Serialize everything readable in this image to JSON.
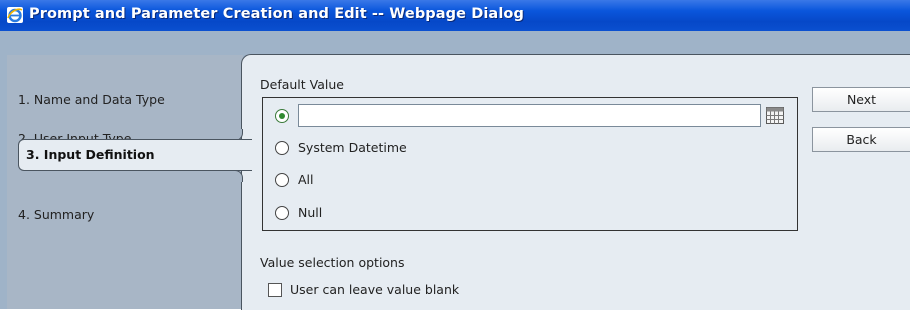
{
  "window": {
    "title": "Prompt and Parameter Creation and Edit -- Webpage Dialog"
  },
  "steps": [
    {
      "label": "1. Name and Data Type",
      "active": false
    },
    {
      "label": "2. User Input Type",
      "active": false
    },
    {
      "label": "3. Input Definition",
      "active": true
    },
    {
      "label": "4. Summary",
      "active": false
    }
  ],
  "default_value": {
    "label": "Default Value",
    "input_value": "",
    "options": [
      {
        "label": "",
        "checked": true
      },
      {
        "label": "System Datetime",
        "checked": false
      },
      {
        "label": "All",
        "checked": false
      },
      {
        "label": "Null",
        "checked": false
      }
    ]
  },
  "buttons": {
    "next": "Next",
    "back": "Back"
  },
  "value_selection": {
    "label": "Value selection options",
    "checkbox_label": "User can leave value blank",
    "checked": false
  },
  "icons": {
    "browser": "internet-explorer-icon",
    "calendar": "calendar-icon"
  },
  "colors": {
    "titlebar": "#0a56dc",
    "frame": "#9fb3c8",
    "panel": "#e6ecf2",
    "radio_selected": "#2f8a2f"
  }
}
